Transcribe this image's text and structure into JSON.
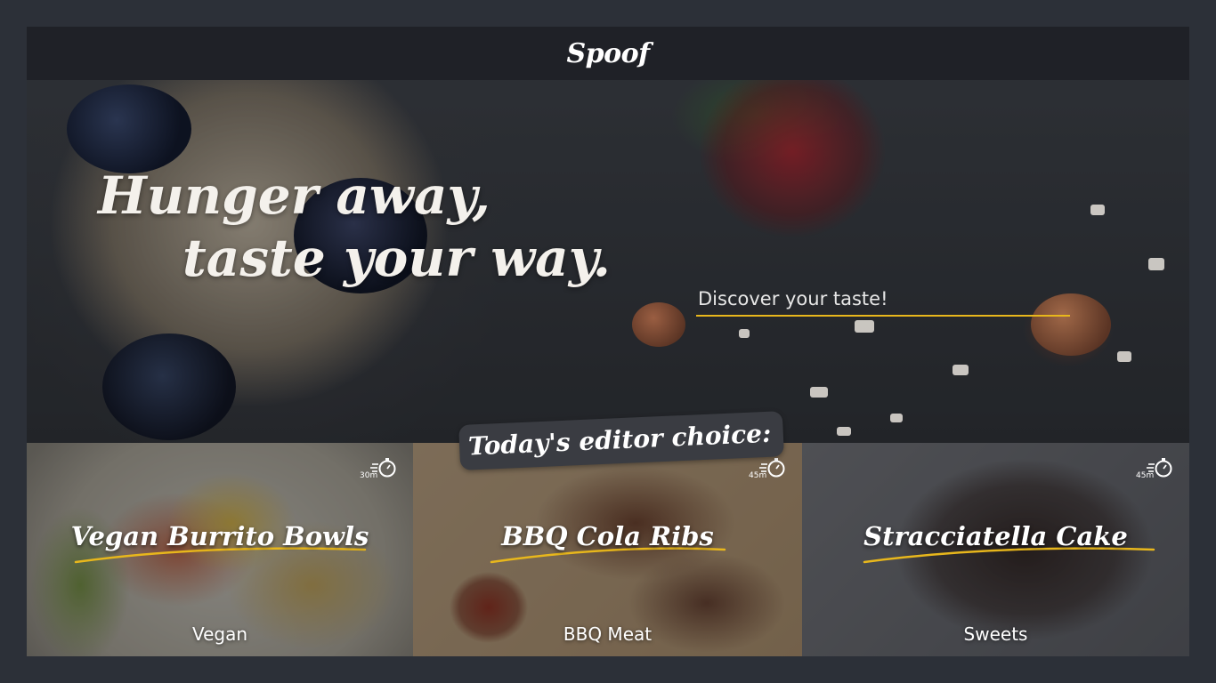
{
  "header": {
    "logo": "Spoof"
  },
  "hero": {
    "headline_line1": "Hunger away,",
    "headline_line2": "taste your way.",
    "search_placeholder": "Discover your taste!"
  },
  "editor_choice": {
    "label": "Today's editor choice:"
  },
  "cards": [
    {
      "title": "Vegan Burrito Bowls",
      "category": "Vegan",
      "time": "30m",
      "icon": "stopwatch-icon"
    },
    {
      "title": "BBQ Cola Ribs",
      "category": "BBQ Meat",
      "time": "45m",
      "icon": "stopwatch-icon"
    },
    {
      "title": "Stracciatella Cake",
      "category": "Sweets",
      "time": "45m",
      "icon": "stopwatch-icon"
    }
  ],
  "colors": {
    "background": "#2c3038",
    "header": "#1f2127",
    "accent": "#e8b71c",
    "badge": "#3a3c42"
  }
}
